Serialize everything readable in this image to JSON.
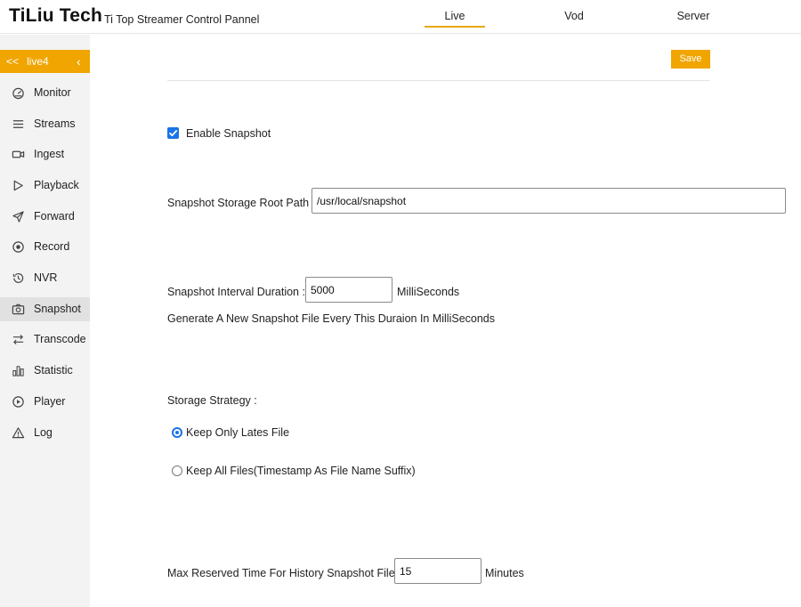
{
  "header": {
    "brand": "TiLiu Tech",
    "subtitle": "Ti Top Streamer Control Pannel",
    "tabs": [
      {
        "label": "Live",
        "active": true
      },
      {
        "label": "Vod",
        "active": false
      },
      {
        "label": "Server",
        "active": false
      }
    ]
  },
  "sidebar": {
    "back": "<<",
    "stream_name": "live4",
    "collapse_glyph": "‹",
    "items": [
      {
        "label": "Monitor",
        "icon": "monitor-icon"
      },
      {
        "label": "Streams",
        "icon": "list-icon"
      },
      {
        "label": "Ingest",
        "icon": "video-camera-icon"
      },
      {
        "label": "Playback",
        "icon": "play-outline-icon"
      },
      {
        "label": "Forward",
        "icon": "send-icon"
      },
      {
        "label": "Record",
        "icon": "record-icon"
      },
      {
        "label": "NVR",
        "icon": "history-icon"
      },
      {
        "label": "Snapshot",
        "icon": "camera-icon",
        "active": true
      },
      {
        "label": "Transcode",
        "icon": "swap-icon"
      },
      {
        "label": "Statistic",
        "icon": "bar-chart-icon"
      },
      {
        "label": "Player",
        "icon": "play-circle-icon"
      },
      {
        "label": "Log",
        "icon": "warning-icon"
      }
    ]
  },
  "main": {
    "save_label": "Save",
    "enable_snapshot_label": "Enable Snapshot",
    "enable_snapshot_checked": true,
    "root_path_label": "Snapshot Storage Root Path :",
    "root_path_value": "/usr/local/snapshot",
    "interval_label": "Snapshot Interval Duration :",
    "interval_value": "5000",
    "interval_unit": "MilliSeconds",
    "interval_hint": "Generate A New Snapshot File Every This Duraion In MilliSeconds",
    "strategy_label": "Storage Strategy :",
    "strategy_options": [
      {
        "label": "Keep Only Lates File",
        "selected": true
      },
      {
        "label": "Keep All Files(Timestamp As File Name Suffix)",
        "selected": false
      }
    ],
    "max_reserved_label": "Max Reserved Time For History Snapshot File :",
    "max_reserved_value": "15",
    "max_reserved_unit": "Minutes"
  },
  "colors": {
    "accent": "#f0a500",
    "checkbox_blue": "#1a73e8",
    "sidebar_bg": "#f3f3f3",
    "sidebar_active": "#e1e1e1"
  }
}
